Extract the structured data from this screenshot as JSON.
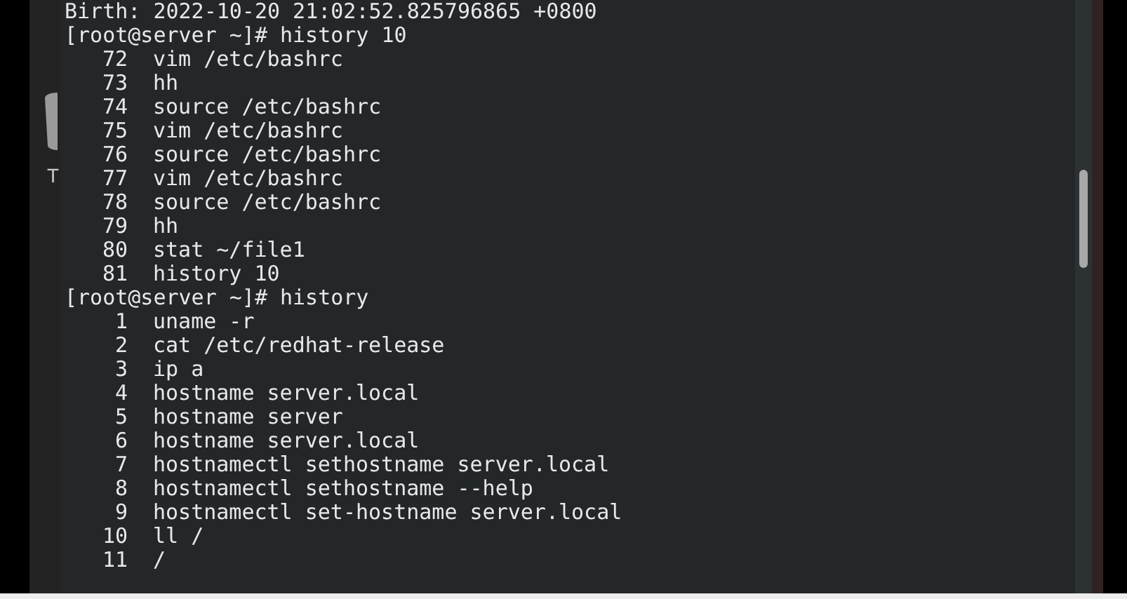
{
  "desktop": {
    "icon_label": "T"
  },
  "terminal": {
    "lines": [
      {
        "kind": "output",
        "text": "Birth: 2022-10-20 21:02:52.825796865 +0800"
      },
      {
        "kind": "prompt",
        "prompt": "[root@server ~]#",
        "command": "history 10"
      },
      {
        "kind": "history",
        "number": "72",
        "command": "vim /etc/bashrc"
      },
      {
        "kind": "history",
        "number": "73",
        "command": "hh"
      },
      {
        "kind": "history",
        "number": "74",
        "command": "source /etc/bashrc"
      },
      {
        "kind": "history",
        "number": "75",
        "command": "vim /etc/bashrc"
      },
      {
        "kind": "history",
        "number": "76",
        "command": "source /etc/bashrc"
      },
      {
        "kind": "history",
        "number": "77",
        "command": "vim /etc/bashrc"
      },
      {
        "kind": "history",
        "number": "78",
        "command": "source /etc/bashrc"
      },
      {
        "kind": "history",
        "number": "79",
        "command": "hh"
      },
      {
        "kind": "history",
        "number": "80",
        "command": "stat ~/file1"
      },
      {
        "kind": "history",
        "number": "81",
        "command": "history 10"
      },
      {
        "kind": "prompt",
        "prompt": "[root@server ~]#",
        "command": "history"
      },
      {
        "kind": "history",
        "number": "1",
        "command": "uname -r"
      },
      {
        "kind": "history",
        "number": "2",
        "command": "cat /etc/redhat-release"
      },
      {
        "kind": "history",
        "number": "3",
        "command": "ip a"
      },
      {
        "kind": "history",
        "number": "4",
        "command": "hostname server.local"
      },
      {
        "kind": "history",
        "number": "5",
        "command": "hostname server"
      },
      {
        "kind": "history",
        "number": "6",
        "command": "hostname server.local"
      },
      {
        "kind": "history",
        "number": "7",
        "command": "hostnamectl sethostname server.local"
      },
      {
        "kind": "history",
        "number": "8",
        "command": "hostnamectl sethostname --help"
      },
      {
        "kind": "history",
        "number": "9",
        "command": "hostnamectl set-hostname server.local"
      },
      {
        "kind": "history",
        "number": "10",
        "command": "ll /"
      },
      {
        "kind": "history",
        "number": "11",
        "command": "/"
      }
    ]
  }
}
